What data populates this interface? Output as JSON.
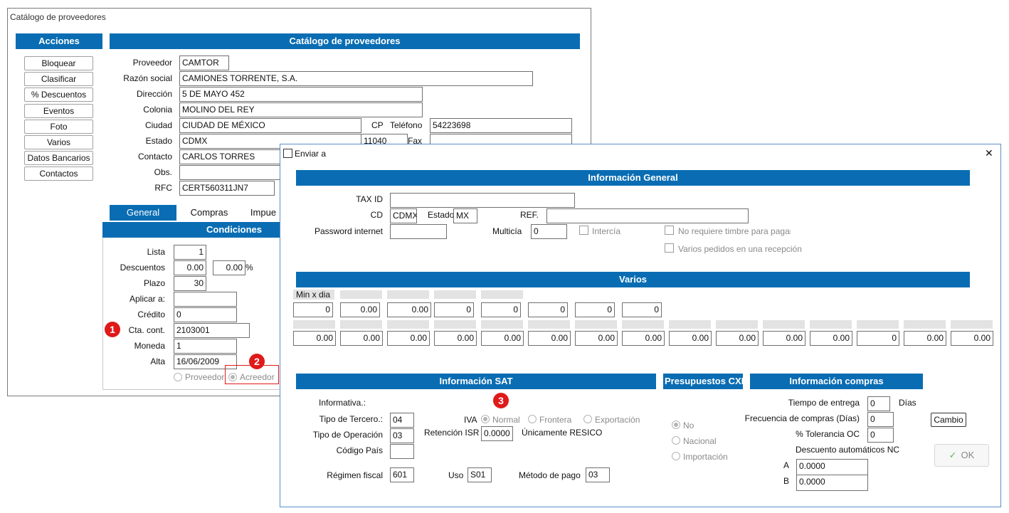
{
  "main": {
    "title": "Catálogo de proveedores",
    "acciones_header": "Acciones",
    "catalog_header": "Catálogo de proveedores",
    "actions": [
      "Bloquear",
      "Clasificar",
      "%  Descuentos",
      "Eventos",
      "Foto",
      "Varios",
      "Datos Bancarios",
      "Contactos"
    ],
    "fields": {
      "proveedor_label": "Proveedor",
      "proveedor": "CAMTOR",
      "razon_label": "Razón social",
      "razon": "CAMIONES TORRENTE, S.A.",
      "direccion_label": "Dirección",
      "direccion": "5 DE MAYO 452",
      "colonia_label": "Colonia",
      "colonia": "MOLINO DEL REY",
      "ciudad_label": "Ciudad",
      "ciudad": "CIUDAD DE MÉXICO",
      "cp_label": "CP",
      "cp": "11040",
      "telefono_label": "Teléfono",
      "telefono": "54223698",
      "estado_label": "Estado",
      "estado": "CDMX",
      "fax_label": "Fax",
      "fax": "",
      "contacto_label": "Contacto",
      "contacto": "CARLOS TORRES",
      "obs_label": "Obs.",
      "obs": "",
      "rfc_label": "RFC",
      "rfc": "CERT560311JN7"
    },
    "tabs": [
      "General",
      "Compras",
      "Impue"
    ],
    "condiciones_header": "Condiciones",
    "condiciones": {
      "lista_label": "Lista",
      "lista": "1",
      "descuentos_label": "Descuentos",
      "desc1": "0.00",
      "desc2": "0.00",
      "pct": "%",
      "plazo_label": "Plazo",
      "plazo": "30",
      "aplicar_label": "Aplicar a:",
      "aplicar": "",
      "credito_label": "Crédito",
      "credito": "0",
      "cta_label": "Cta. cont.",
      "cta": "2103001",
      "moneda_label": "Moneda",
      "moneda": "1",
      "alta_label": "Alta",
      "alta": "16/06/2009",
      "proveedor_radio": "Proveedor",
      "acreedor_radio": "Acreedor"
    },
    "badges": [
      "1",
      "2",
      "3"
    ]
  },
  "dialog": {
    "title": "Enviar a",
    "close": "✕",
    "info_general_header": "Información General",
    "taxid_label": "TAX ID",
    "taxid": "",
    "cd_label": "CD",
    "cd": "CDMX",
    "estado_label": "Estado",
    "estado": "MX",
    "ref_label": "REF.",
    "ref": "",
    "password_label": "Password internet",
    "password": "",
    "multicia_label": "Multicía",
    "multicia": "0",
    "intercia_label": "Intercía",
    "timbre_label": "No requiere timbre para pagar",
    "varios_pedidos_label": "Varios pedidos en una recepción",
    "varios_header": "Varios",
    "min_x_dia": "Min x dia",
    "row1": [
      "0",
      "0.00",
      "0.00",
      "0",
      "0",
      "0",
      "0",
      "0"
    ],
    "row2": [
      "0.00",
      "0.00",
      "0.00",
      "0.00",
      "0.00",
      "0.00",
      "0.00",
      "0.00",
      "0.00",
      "0.00",
      "0.00",
      "0.00",
      "0",
      "0.00",
      "0.00"
    ],
    "sat_header": "Información SAT",
    "informativa_label": "Informativa.:",
    "tipo_tercero_label": "Tipo de Tercero.:",
    "tipo_tercero": "04",
    "tipo_operacion_label": "Tipo de Operación",
    "tipo_operacion": "03",
    "codigo_pais_label": "Código País",
    "codigo_pais": "",
    "regimen_label": "Régimen fiscal",
    "regimen": "601",
    "iva_label": "IVA",
    "iva_normal": "Normal",
    "iva_frontera": "Frontera",
    "iva_exportacion": "Exportación",
    "retencion_label": "Retención ISR",
    "retencion": "0.0000",
    "resico_label": "Únicamente RESICO",
    "uso_label": "Uso",
    "uso": "S01",
    "metodo_label": "Método de pago",
    "metodo": "03",
    "presupuestos_header": "Presupuestos CXP",
    "pres_no": "No",
    "pres_nacional": "Nacional",
    "pres_importacion": "Importación",
    "compras_header": "Información compras",
    "tiempo_label": "Tiempo de entrega",
    "tiempo": "0",
    "dias_label": "Días",
    "frecuencia_label": "Frecuencia de compras (Días)",
    "frecuencia": "0",
    "tolerancia_label": "% Tolerancia OC",
    "tolerancia": "0",
    "cambio_button": "Cambio",
    "descuento_nc_label": "Descuento automáticos NC",
    "a_label": "A",
    "a_value": "0.0000",
    "b_label": "B",
    "b_value": "0.0000",
    "ok_icon": "✓",
    "ok_label": "OK"
  }
}
